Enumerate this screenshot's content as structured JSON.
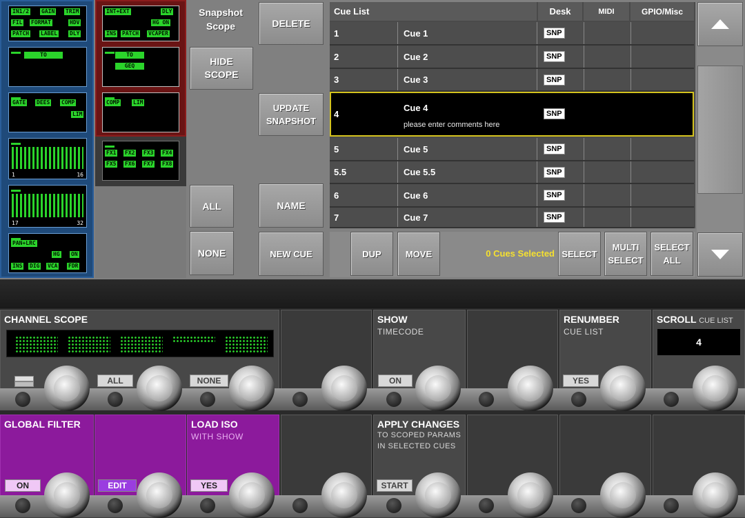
{
  "scope_boxes": {
    "input_tags_row1": [
      "IN1/2",
      "GAIN",
      "TRIM"
    ],
    "input_tags_row2": [
      "FIL",
      "FORMAT",
      "HDV"
    ],
    "input_tags_row3": [
      "PATCH",
      "LABEL",
      "DLY"
    ],
    "to_tag": "TO",
    "dyn_tags_row1": [
      "GATE",
      "DEES",
      "COMP"
    ],
    "dyn_tag_lim": "LIM",
    "bar_left_1": "1",
    "bar_right_1": "16",
    "bar_left_2": "17",
    "bar_right_2": "32",
    "pan_tag": "PAN+LRC",
    "pan_tags_row2": [
      "HG",
      "ON"
    ],
    "pan_tags_row3": [
      "INS",
      "DIG",
      "VCA",
      "FDR"
    ],
    "red_tags_row1": [
      "INT+EXT",
      "DLY"
    ],
    "red_tag_hgon": "HG ON",
    "red_tags_row3": [
      "INS",
      "PATCH",
      "VCAPER"
    ],
    "red_to": "TO",
    "red_geq": "GEQ",
    "red_comp": [
      "COMP",
      "LIM"
    ],
    "red_fx_row1": [
      "FX1",
      "FX2",
      "FX3",
      "FX4"
    ],
    "red_fx_row2": [
      "FX5",
      "FX6",
      "FX7",
      "FX8"
    ]
  },
  "buttons": {
    "snapshot_scope": "Snapshot Scope",
    "hide_scope": "HIDE SCOPE",
    "all": "ALL",
    "none": "NONE",
    "delete": "DELETE",
    "update_snapshot": "UPDATE SNAPSHOT",
    "name": "NAME",
    "new_cue": "NEW CUE",
    "dup": "DUP",
    "move": "MOVE",
    "cues_selected": "0  Cues Selected",
    "select": "SELECT",
    "multi_select": "MULTI SELECT",
    "select_all": "SELECT ALL"
  },
  "cue_list": {
    "headers": {
      "list": "Cue List",
      "desk": "Desk",
      "midi": "MIDI",
      "gpio": "GPIO/Misc"
    },
    "rows": [
      {
        "num": "1",
        "name": "Cue 1",
        "desk": "SNP"
      },
      {
        "num": "2",
        "name": "Cue 2",
        "desk": "SNP"
      },
      {
        "num": "3",
        "name": "Cue 3",
        "desk": "SNP"
      },
      {
        "num": "4",
        "name": "Cue 4",
        "comment": "please enter comments here",
        "desk": "SNP"
      },
      {
        "num": "5",
        "name": "Cue 5",
        "desk": "SNP"
      },
      {
        "num": "5.5",
        "name": "Cue 5.5",
        "desk": "SNP"
      },
      {
        "num": "6",
        "name": "Cue 6",
        "desk": "SNP"
      },
      {
        "num": "7",
        "name": "Cue 7",
        "desk": "SNP"
      }
    ]
  },
  "scroll_icons": {
    "up": "arrow-up-icon",
    "down": "arrow-down-icon"
  },
  "panels": {
    "channel_scope": {
      "title": "CHANNEL SCOPE",
      "all": "ALL",
      "none": "NONE"
    },
    "show": {
      "title": "SHOW",
      "sub": "TIMECODE",
      "btn": "ON"
    },
    "renumber": {
      "title": "RENUMBER",
      "sub": "CUE LIST",
      "btn": "YES"
    },
    "scroll": {
      "title": "SCROLL",
      "sub": "CUE LIST",
      "value": "4"
    },
    "global_filter": {
      "title": "GLOBAL FILTER",
      "btn": "ON",
      "edit": "EDIT"
    },
    "load_iso": {
      "title": "LOAD ISO",
      "sub": "WITH SHOW",
      "btn": "YES"
    },
    "apply_changes": {
      "title": "APPLY CHANGES",
      "sub1": "TO SCOPED PARAMS",
      "sub2": "IN SELECTED CUES",
      "btn": "START"
    }
  },
  "colors": {
    "lcd_green": "#2bd42b",
    "selected_border": "#d4c31e",
    "cues_selected_text": "#f5e030",
    "purple_panel": "#8c1a9c"
  }
}
